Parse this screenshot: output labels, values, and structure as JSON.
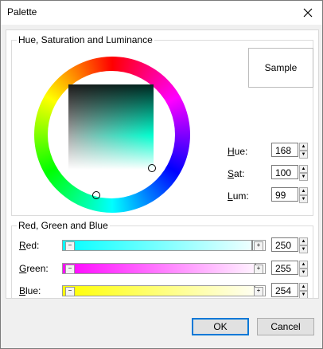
{
  "window": {
    "title": "Palette"
  },
  "hsl": {
    "legend": "Hue, Saturation and Luminance",
    "sample_label": "Sample",
    "hue_label": "Hue:",
    "sat_label": "Sat:",
    "lum_label": "Lum:",
    "hue": "168",
    "sat": "100",
    "lum": "99"
  },
  "rgb": {
    "legend": "Red, Green and Blue",
    "red_label": "Red:",
    "green_label": "Green:",
    "blue_label": "Blue:",
    "red": "250",
    "green": "255",
    "blue": "254"
  },
  "buttons": {
    "ok": "OK",
    "cancel": "Cancel"
  },
  "icons": {
    "close": "close-icon",
    "spin_up": "spin-up-icon",
    "spin_down": "spin-down-icon"
  },
  "colors": {
    "accent": "#0078d7"
  }
}
